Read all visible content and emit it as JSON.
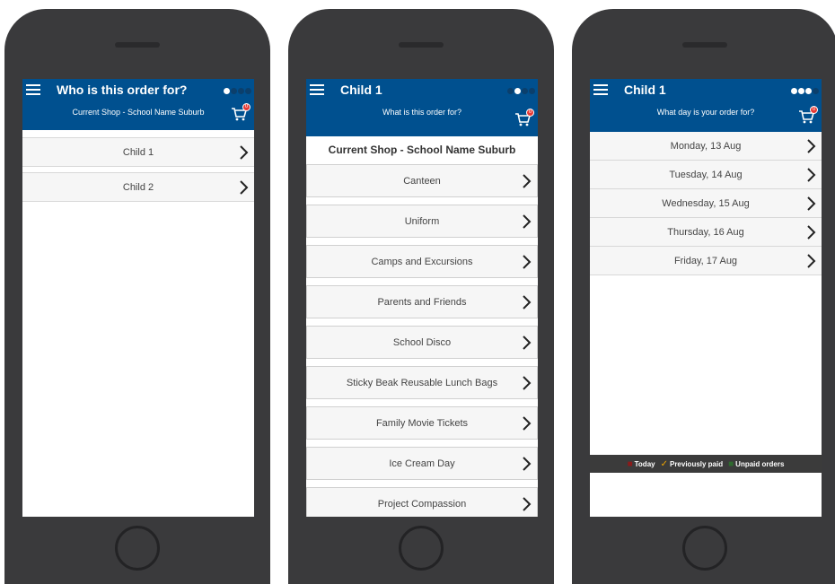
{
  "colors": {
    "appbar": "#00508f",
    "phone_body": "#3a3a3c",
    "badge": "#e53935",
    "today": "#8b1a1a",
    "paid": "#f0a500",
    "unpaid": "#2e6b2e"
  },
  "icons": {
    "menu": "hamburger-icon",
    "cart": "shopping-cart-icon",
    "next": "chevron-right-icon",
    "check": "check-icon"
  },
  "screen1": {
    "title": "Who is this order for?",
    "subtitle": "Current Shop - School Name Suburb",
    "cart_count": "0",
    "children": [
      "Child 1",
      "Child 2"
    ]
  },
  "screen2": {
    "title": "Child 1",
    "subtitle": "What is this order for?",
    "cart_count": "0",
    "shop_heading": "Current Shop - School Name Suburb",
    "categories": [
      "Canteen",
      "Uniform",
      "Camps and Excursions",
      "Parents and Friends",
      "School Disco",
      "Sticky Beak Reusable Lunch Bags",
      "Family Movie Tickets",
      "Ice Cream Day",
      "Project Compassion"
    ]
  },
  "screen3": {
    "title": "Child 1",
    "subtitle": "What day is your order for?",
    "cart_count": "0",
    "days": [
      "Monday, 13 Aug",
      "Tuesday, 14 Aug",
      "Wednesday, 15 Aug",
      "Thursday, 16 Aug",
      "Friday, 17 Aug"
    ],
    "legend": {
      "today": "Today",
      "paid": "Previously paid",
      "unpaid": "Unpaid orders"
    }
  }
}
